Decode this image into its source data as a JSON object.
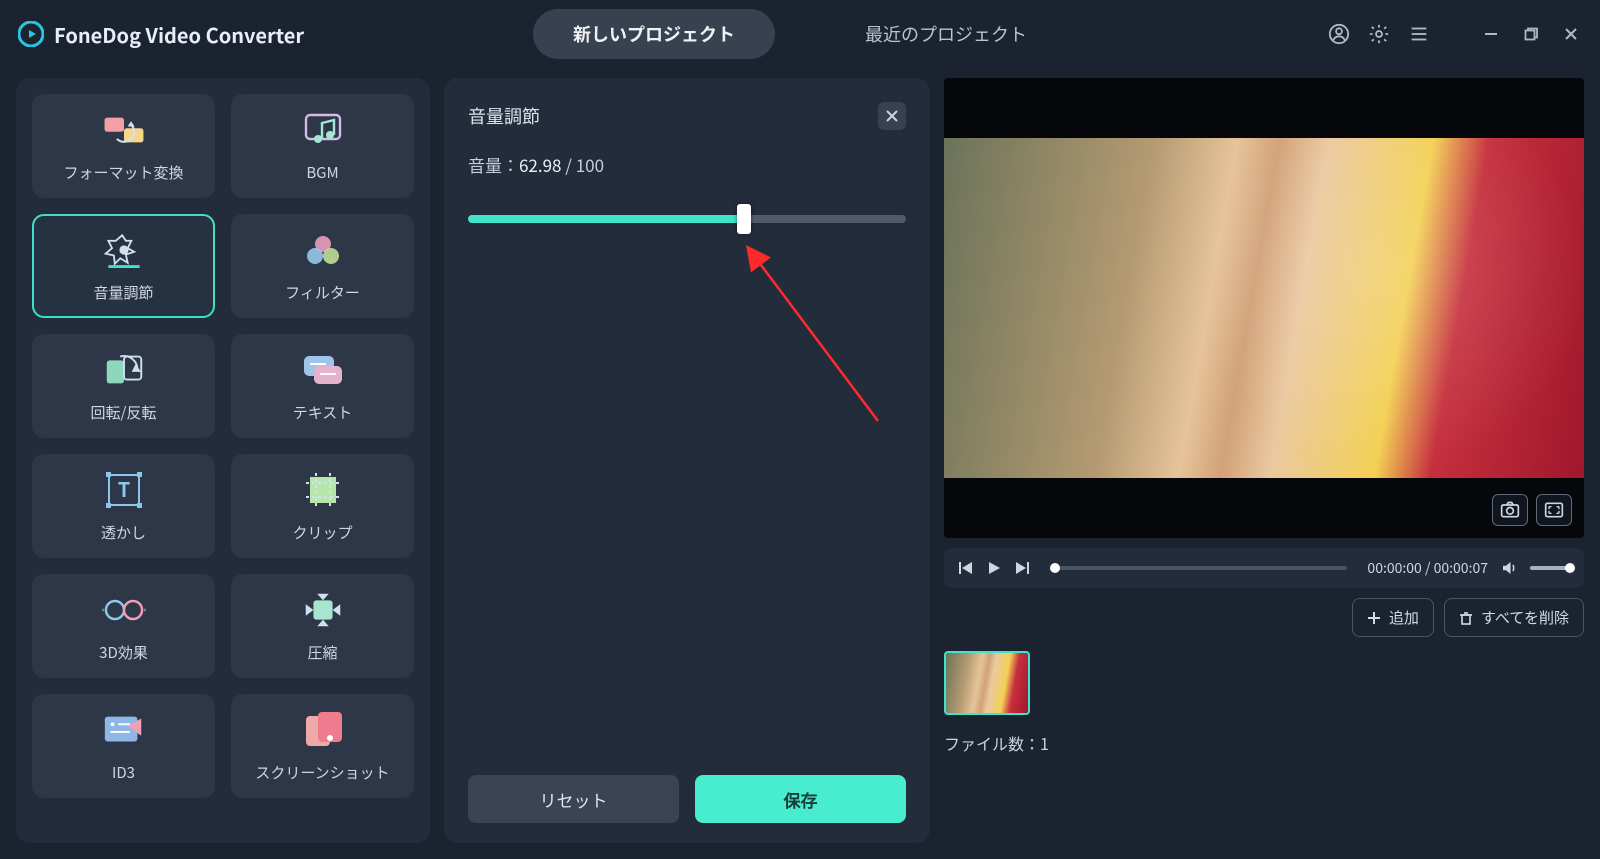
{
  "app": {
    "title": "FoneDog Video Converter"
  },
  "tabs": {
    "new_project": "新しいプロジェクト",
    "recent_projects": "最近のプロジェクト",
    "active": "new_project"
  },
  "tools": [
    {
      "id": "format-convert",
      "label": "フォーマット変換"
    },
    {
      "id": "bgm",
      "label": "BGM"
    },
    {
      "id": "volume-adjust",
      "label": "音量調節",
      "active": true
    },
    {
      "id": "filter",
      "label": "フィルター"
    },
    {
      "id": "rotate-flip",
      "label": "回転/反転"
    },
    {
      "id": "text",
      "label": "テキスト"
    },
    {
      "id": "watermark",
      "label": "透かし"
    },
    {
      "id": "clip",
      "label": "クリップ"
    },
    {
      "id": "3d-effect",
      "label": "3D効果"
    },
    {
      "id": "compress",
      "label": "圧縮"
    },
    {
      "id": "id3",
      "label": "ID3"
    },
    {
      "id": "screenshot",
      "label": "スクリーンショット"
    }
  ],
  "panel": {
    "title": "音量調節",
    "volume_prefix": "音量：",
    "volume_value": "62.98",
    "volume_suffix": " / 100",
    "volume_percent": 62.98,
    "reset_label": "リセット",
    "save_label": "保存"
  },
  "player": {
    "current": "00:00:00",
    "duration": "00:00:07",
    "separator": " / "
  },
  "filelist": {
    "add_label": "追加",
    "delete_all_label": "すべてを削除",
    "count_prefix": "ファイル数：",
    "count": "1"
  }
}
